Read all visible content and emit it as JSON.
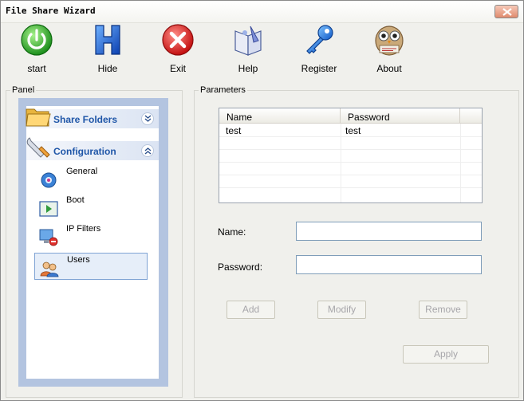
{
  "window": {
    "title": "File Share Wizard"
  },
  "toolbar": {
    "start": {
      "label": "start",
      "icon": "power-icon"
    },
    "hide": {
      "label": "Hide",
      "icon": "h-letter-icon"
    },
    "exit": {
      "label": "Exit",
      "icon": "close-x-icon"
    },
    "help": {
      "label": "Help",
      "icon": "help-book-icon"
    },
    "register": {
      "label": "Register",
      "icon": "key-icon"
    },
    "about": {
      "label": "About",
      "icon": "readme-owl-icon"
    }
  },
  "panel": {
    "title": "Panel",
    "sections": [
      {
        "label": "Share Folders",
        "icon": "folder-icon",
        "expanded": false
      },
      {
        "label": "Configuration",
        "icon": "wrench-icon",
        "expanded": true
      }
    ],
    "items": [
      {
        "label": "General",
        "icon": "gear-icon"
      },
      {
        "label": "Boot",
        "icon": "boot-window-icon"
      },
      {
        "label": "IP Filters",
        "icon": "ip-filter-icon"
      },
      {
        "label": "Users",
        "icon": "users-icon",
        "selected": true
      }
    ]
  },
  "parameters": {
    "title": "Parameters",
    "table": {
      "columns": [
        "Name",
        "Password"
      ],
      "rows": [
        [
          "test",
          "test"
        ]
      ]
    },
    "name_label": "Name:",
    "name_value": "",
    "password_label": "Password:",
    "password_value": "",
    "buttons": {
      "add": "Add",
      "modify": "Modify",
      "remove": "Remove",
      "apply": "Apply"
    }
  },
  "colors": {
    "window_bg": "#f0f0ec",
    "nav_frame": "#b3c4e0",
    "section_text": "#1f56a8",
    "disabled_text": "#a7a6aa",
    "selection_border": "#7fa3d4"
  }
}
